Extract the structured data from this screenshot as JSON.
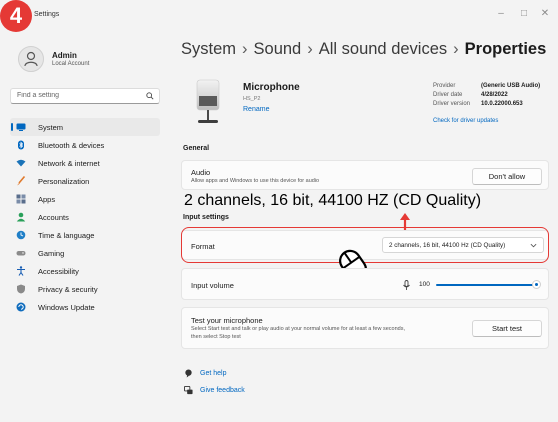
{
  "step_badge": "4",
  "window": {
    "title": "Settings",
    "controls": [
      "–",
      "□",
      "✕"
    ]
  },
  "user": {
    "name": "Admin",
    "subtitle": "Local Account"
  },
  "search": {
    "placeholder": "Find a setting"
  },
  "nav": [
    {
      "label": "System",
      "icon": "monitor-icon",
      "color": "#0067c0",
      "active": true
    },
    {
      "label": "Bluetooth & devices",
      "icon": "bluetooth-icon",
      "color": "#0067c0"
    },
    {
      "label": "Network & internet",
      "icon": "wifi-icon",
      "color": "#1a73b8"
    },
    {
      "label": "Personalization",
      "icon": "brush-icon",
      "color": "#e07a2c"
    },
    {
      "label": "Apps",
      "icon": "apps-icon",
      "color": "#5a6e8c"
    },
    {
      "label": "Accounts",
      "icon": "person-icon",
      "color": "#2aa05a"
    },
    {
      "label": "Time & language",
      "icon": "globe-clock-icon",
      "color": "#1f7fc7"
    },
    {
      "label": "Gaming",
      "icon": "gamepad-icon",
      "color": "#8a8a8a"
    },
    {
      "label": "Accessibility",
      "icon": "accessibility-icon",
      "color": "#1a5fb4"
    },
    {
      "label": "Privacy & security",
      "icon": "shield-icon",
      "color": "#8a8a8a"
    },
    {
      "label": "Windows Update",
      "icon": "update-icon",
      "color": "#0f6cbd"
    }
  ],
  "breadcrumb": [
    "System",
    "Sound",
    "All sound devices",
    "Properties"
  ],
  "device": {
    "name": "Microphone",
    "subtitle": "HS_P2",
    "rename": "Rename"
  },
  "properties": [
    {
      "key": "Provider",
      "value": "(Generic USB Audio)"
    },
    {
      "key": "Driver date",
      "value": "4/28/2022"
    },
    {
      "key": "Driver version",
      "value": "10.0.22000.653"
    }
  ],
  "driver_link": "Check for driver updates",
  "general": {
    "title": "General",
    "audio": {
      "title": "Audio",
      "subtitle": "Allow apps and Windows to use this device for audio",
      "button": "Don't allow"
    }
  },
  "annotation": "2 channels, 16 bit, 44100 HZ (CD Quality)",
  "input_settings": {
    "title": "Input settings",
    "format": {
      "label": "Format",
      "value": "2 channels, 16 bit, 44100 Hz (CD Quality)"
    },
    "volume": {
      "label": "Input volume",
      "value": "100",
      "level": 1.0
    },
    "test": {
      "title": "Test your microphone",
      "subtitle1": "Select Start test and talk or play audio at your normal volume for at least a few seconds,",
      "subtitle2": "then select Stop test",
      "button": "Start test"
    }
  },
  "footer": {
    "help": "Get help",
    "feedback": "Give feedback"
  },
  "colors": {
    "accent": "#0067c0",
    "highlight": "#e53935"
  }
}
